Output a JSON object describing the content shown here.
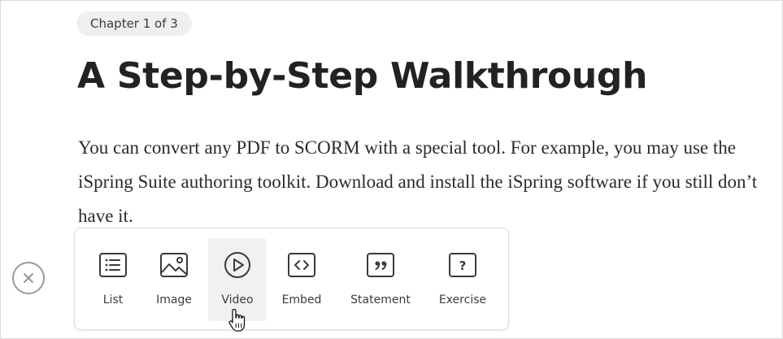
{
  "chapter_badge": "Chapter 1 of 3",
  "title": "A Step-by-Step Walkthrough",
  "body_text": "You can convert any PDF to SCORM with a special tool. For example, you may use the iSpring Suite authoring toolkit. Download and install the iSpring software if you still don’t have it.",
  "toolbar": {
    "items": [
      {
        "label": "List",
        "icon": "list-icon"
      },
      {
        "label": "Image",
        "icon": "image-icon"
      },
      {
        "label": "Video",
        "icon": "play-icon",
        "active": true
      },
      {
        "label": "Embed",
        "icon": "code-icon"
      },
      {
        "label": "Statement",
        "icon": "quote-icon"
      },
      {
        "label": "Exercise",
        "icon": "question-icon"
      }
    ]
  },
  "close_icon": "close-icon",
  "cursor_icon": "hand-pointer-icon",
  "colors": {
    "badge_bg": "#efefef",
    "icon_stroke": "#3a3a3a",
    "active_tool_bg": "#f1f1f1",
    "close_stroke": "#9a9a9a"
  }
}
